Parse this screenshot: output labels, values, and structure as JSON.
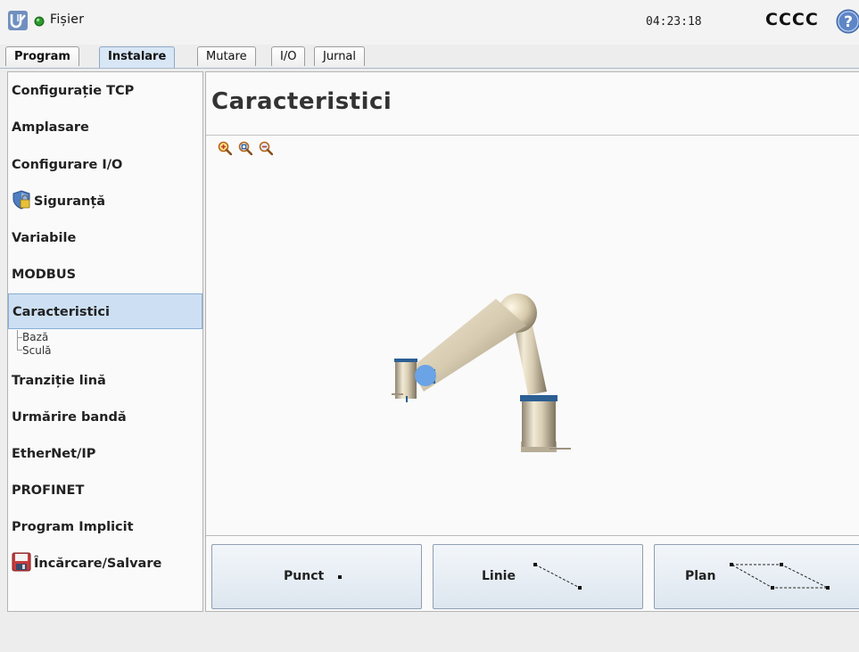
{
  "topbar": {
    "menu_label": "Fișier",
    "time": "04:23:18",
    "robot_name": "CCCC",
    "status_color": "#2e9c2e"
  },
  "tabs": [
    {
      "label": "Program"
    },
    {
      "label": "Instalare"
    },
    {
      "label": "Mutare"
    },
    {
      "label": "I/O"
    },
    {
      "label": "Jurnal"
    }
  ],
  "sidebar": {
    "items": [
      {
        "label": "Configurație TCP"
      },
      {
        "label": "Amplasare"
      },
      {
        "label": "Configurare I/O"
      },
      {
        "label": "Siguranță",
        "icon": "shield-icon"
      },
      {
        "label": "Variabile"
      },
      {
        "label": "MODBUS"
      },
      {
        "label": "Caracteristici"
      },
      {
        "label": "Tranziție lină"
      },
      {
        "label": "Urmărire bandă"
      },
      {
        "label": "EtherNet/IP"
      },
      {
        "label": "PROFINET"
      },
      {
        "label": "Program Implicit"
      },
      {
        "label": "Încărcare/Salvare",
        "icon": "floppy-disk-icon"
      }
    ],
    "sub_items": [
      {
        "label": "Bază"
      },
      {
        "label": "Sculă"
      }
    ]
  },
  "main": {
    "title": "Caracteristici",
    "zoom_icons": [
      "zoom-in-icon",
      "zoom-reset-icon",
      "zoom-out-icon"
    ],
    "buttons": [
      {
        "label": "Punct"
      },
      {
        "label": "Linie"
      },
      {
        "label": "Plan"
      }
    ]
  }
}
